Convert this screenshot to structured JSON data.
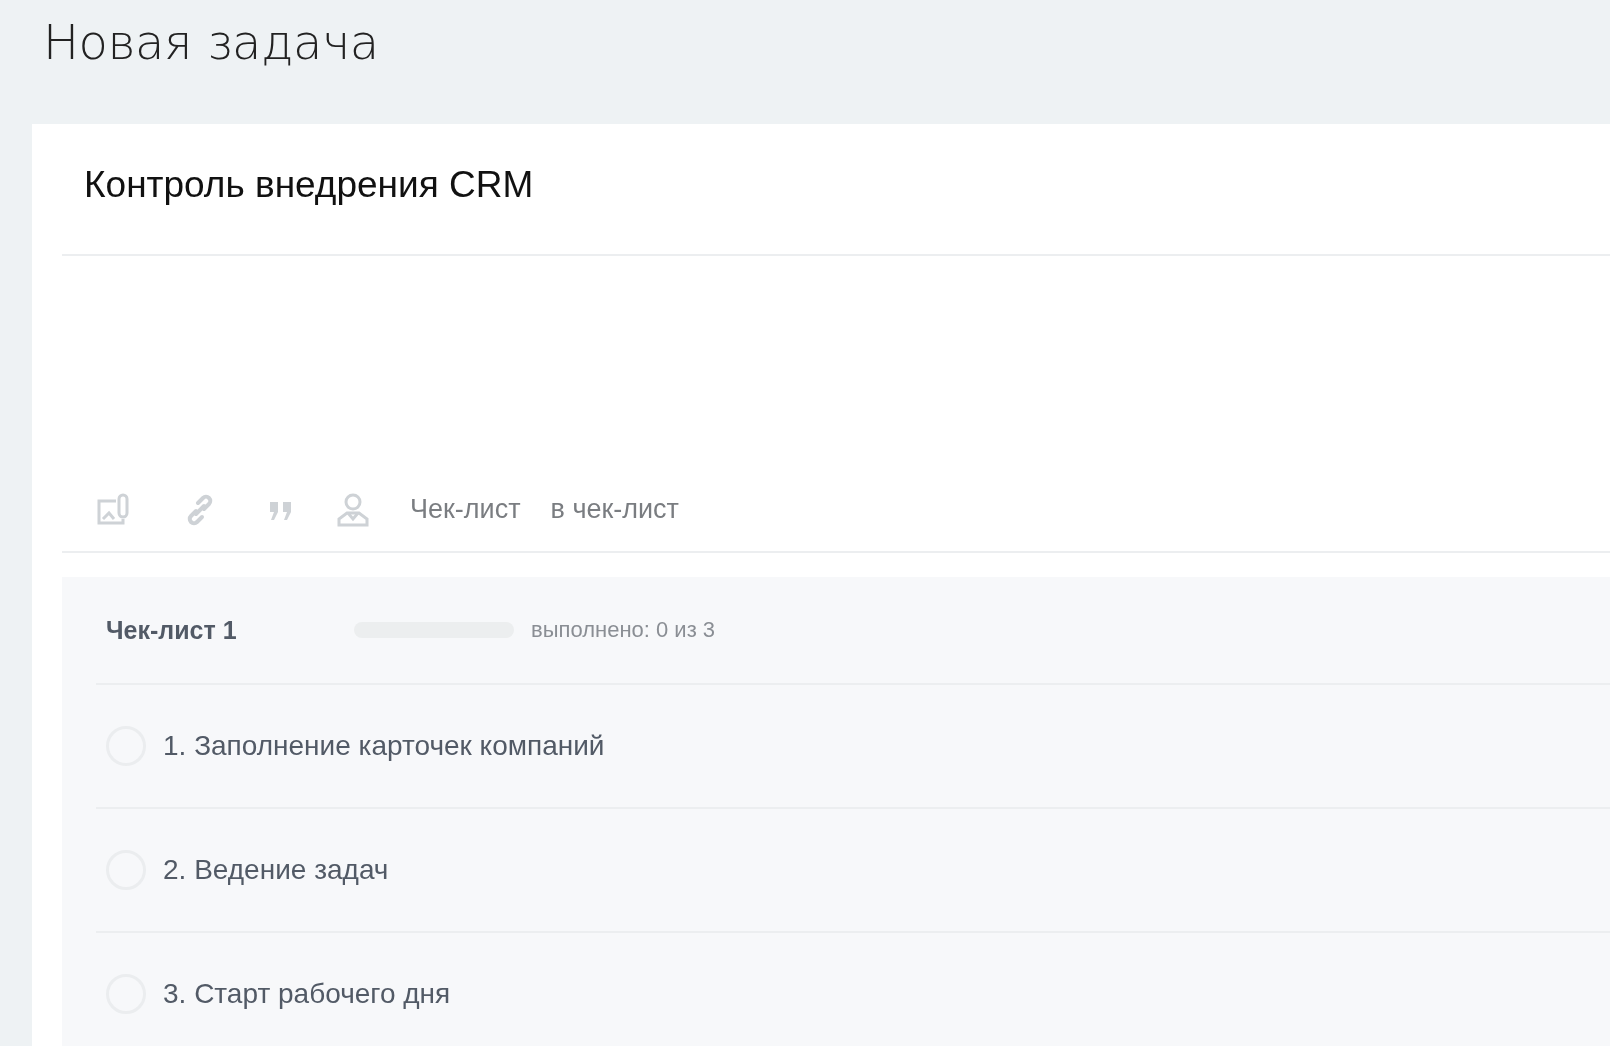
{
  "page": {
    "title": "Новая задача"
  },
  "task": {
    "title": "Контроль внедрения CRM"
  },
  "toolbar": {
    "text_buttons": [
      "Чек-лист",
      "в чек-лист"
    ]
  },
  "checklist": {
    "title": "Чек-лист 1",
    "progress": {
      "level": 0,
      "reading": "выполнено: 0 из 3"
    },
    "items": [
      {
        "text": "1. Заполнение карточек компаний",
        "checked": false
      },
      {
        "text": "2. Ведение задач",
        "checked": false
      },
      {
        "text": "3. Старт рабочего дня",
        "checked": false
      }
    ]
  }
}
